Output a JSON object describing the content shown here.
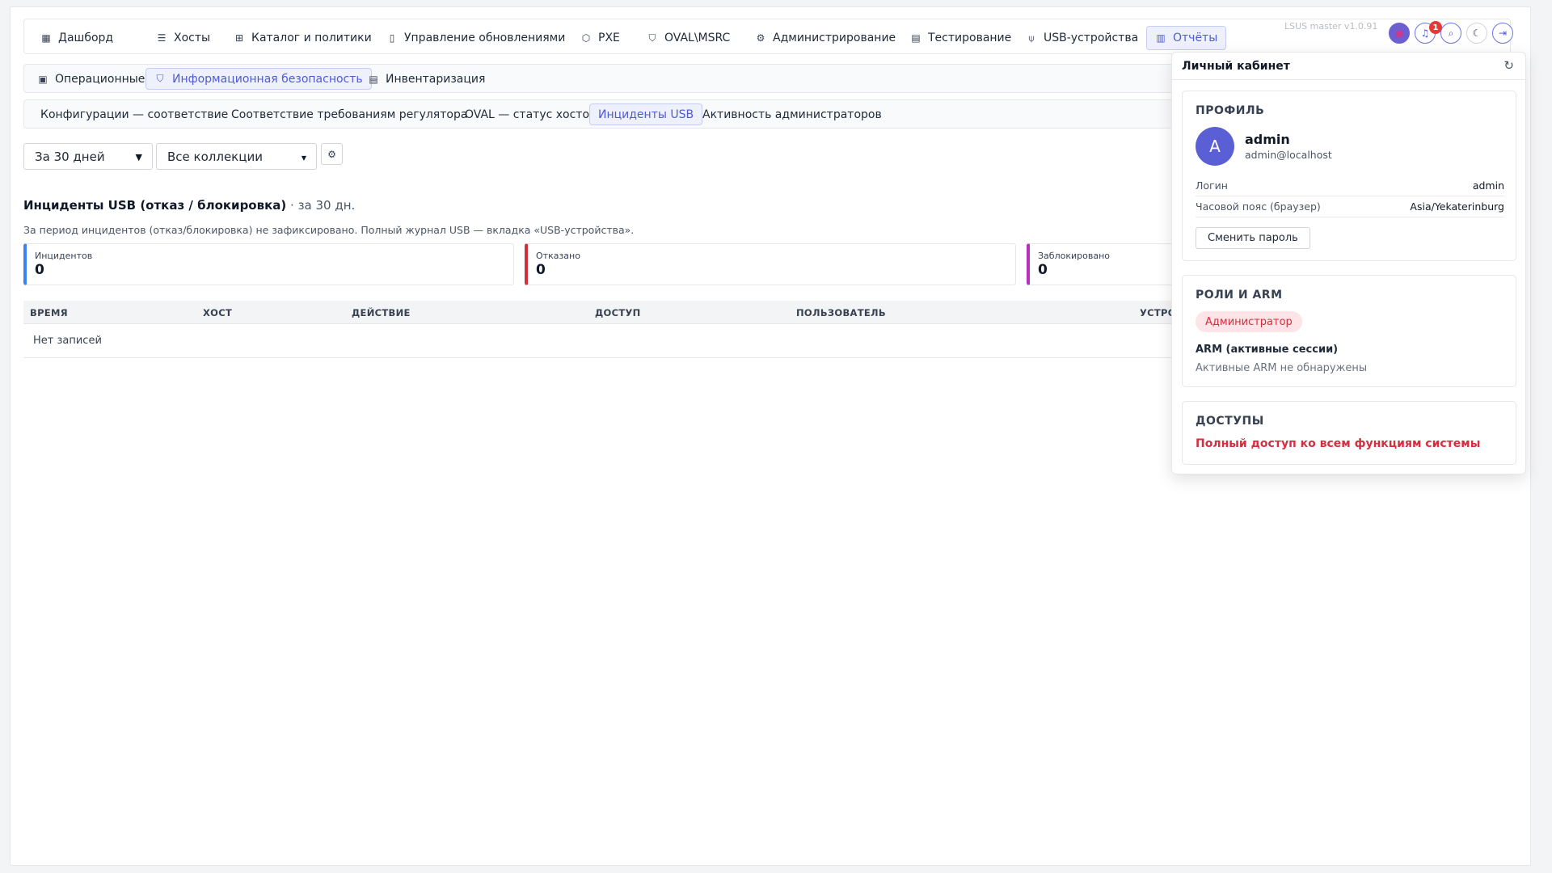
{
  "top_nav": {
    "items": [
      {
        "label": "Дашборд",
        "icon": "dashboard-icon"
      },
      {
        "label": "Хосты",
        "icon": "server-icon"
      },
      {
        "label": "Каталог и политики",
        "icon": "tree-icon"
      },
      {
        "label": "Управление обновлениями",
        "icon": "update-file-icon"
      },
      {
        "label": "PXE",
        "icon": "box-icon"
      },
      {
        "label": "OVAL\\MSRC",
        "icon": "shield-check-icon"
      },
      {
        "label": "Администрирование",
        "icon": "admin-gear-icon"
      },
      {
        "label": "Тестирование",
        "icon": "test-icon"
      },
      {
        "label": "USB-устройства",
        "icon": "usb-icon"
      },
      {
        "label": "Отчёты",
        "icon": "report-icon"
      }
    ],
    "active": "Отчёты",
    "version": "LSUS master v1.0.91",
    "notifications_count": "1"
  },
  "sub_nav": {
    "items": [
      {
        "label": "Операционные",
        "icon": "calendar-icon"
      },
      {
        "label": "Информационная безопасность",
        "icon": "shield-icon"
      },
      {
        "label": "Инвентаризация",
        "icon": "archive-icon"
      }
    ],
    "active": "Информационная безопасность"
  },
  "report_tabs": {
    "items": [
      "Конфигурации — соответствие",
      "Соответствие требованиям регулятора",
      "OVAL — статус хостов",
      "Инциденты USB",
      "Активность администраторов"
    ],
    "active": "Инциденты USB"
  },
  "filters": {
    "period": "За 30 дней",
    "collection": "Все коллекции"
  },
  "report": {
    "title": "Инциденты USB (отказ / блокировка)",
    "period": " · за 30 дн.",
    "note": "За период инцидентов (отказ/блокировка) не зафиксировано. Полный журнал USB — вкладка «USB-устройства»."
  },
  "stats": [
    {
      "label": "Инцидентов",
      "value": "0",
      "color": "#3b82f6"
    },
    {
      "label": "Отказано",
      "value": "0",
      "color": "#d32f3f"
    },
    {
      "label": "Заблокировано",
      "value": "0",
      "color": "#b82fc4"
    }
  ],
  "table": {
    "columns": [
      "ВРЕМЯ",
      "ХОСТ",
      "ДЕЙСТВИЕ",
      "ДОСТУП",
      "ПОЛЬЗОВАТЕЛЬ",
      "УСТРОЙ"
    ],
    "empty_text": "Нет записей"
  },
  "profile_panel": {
    "title": "Личный кабинет",
    "profile": {
      "section_title": "ПРОФИЛЬ",
      "avatar_letter": "A",
      "username": "admin",
      "email": "admin@localhost",
      "login_label": "Логин",
      "login_value": "admin",
      "tz_label": "Часовой пояс (браузер)",
      "tz_value": "Asia/Yekaterinburg",
      "change_password": "Сменить пароль"
    },
    "roles": {
      "section_title": "РОЛИ И ARM",
      "role": "Администратор",
      "arm_label": "ARM (активные сессии)",
      "arm_none": "Активные ARM не обнаружены"
    },
    "access": {
      "section_title": "ДОСТУПЫ",
      "text": "Полный доступ ко всем функциям системы"
    }
  }
}
